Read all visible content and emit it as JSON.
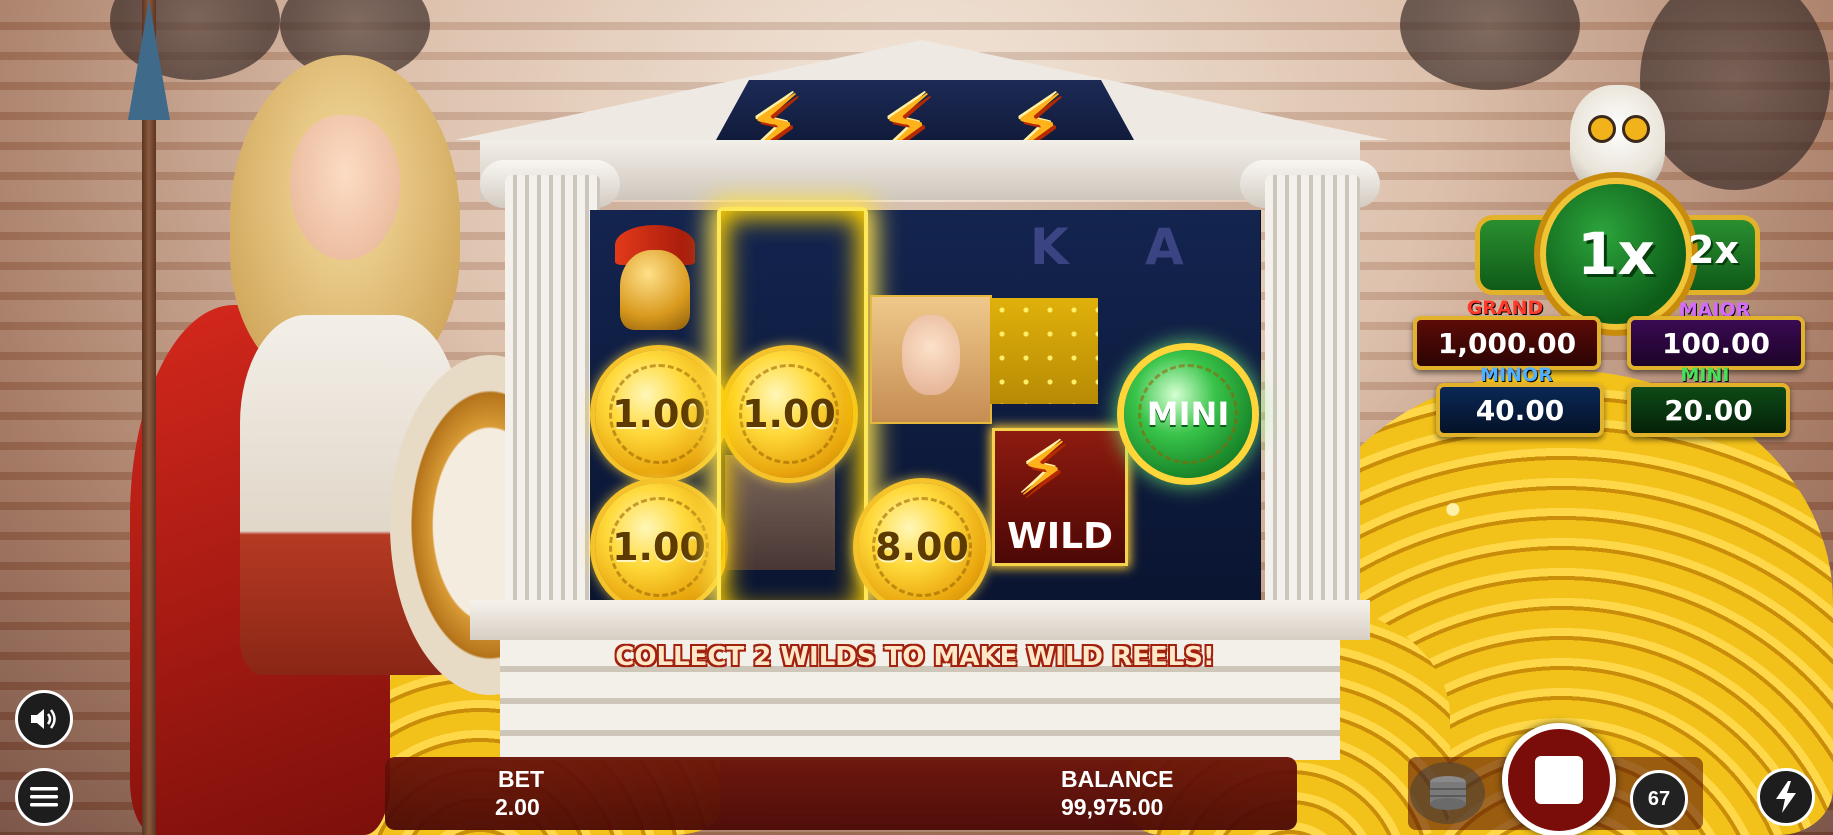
{
  "reels": {
    "coin_values": [
      "1.00",
      "1.00",
      "1.00",
      "8.00"
    ],
    "mini_coin_label": "MINI",
    "wild_label": "WILD"
  },
  "message": "COLLECT 2 WILDS TO MAKE WILD REELS!",
  "multiplier": {
    "current": "1x",
    "next": "2x"
  },
  "jackpots": {
    "grand_label": "GRAND",
    "grand_value": "1,000.00",
    "major_label": "MAJOR",
    "major_value": "100.00",
    "minor_label": "MINOR",
    "minor_value": "40.00",
    "mini_label": "MINI",
    "mini_value": "20.00"
  },
  "bottom_bar": {
    "bet_label": "BET",
    "bet_value": "2.00",
    "balance_label": "BALANCE",
    "balance_value": "99,975.00",
    "autoplay_count": "67"
  },
  "icons": {
    "sound": "speaker-icon",
    "menu": "hamburger-menu-icon",
    "stop": "stop-square-icon",
    "turbo": "lightning-icon",
    "coin_stack": "coin-stack-icon"
  },
  "colors": {
    "grand": "#e8251c",
    "major": "#c24dff",
    "minor": "#3aa0ff",
    "mini": "#3ad24a",
    "gold": "#e3b22b"
  }
}
